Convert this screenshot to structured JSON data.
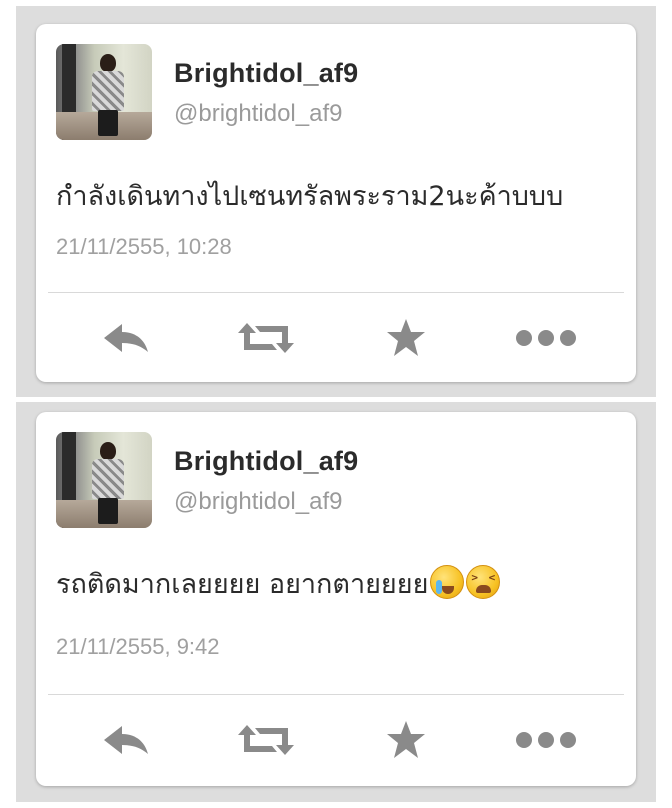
{
  "colors": {
    "background": "#dddddd",
    "card": "#ffffff",
    "name_text": "#2b2b2b",
    "meta_text": "#9a9a9a",
    "icon": "#8a8a8a"
  },
  "tweets": [
    {
      "name": "Brightidol_af9",
      "handle": "@brightidol_af9",
      "text": "กำลังเดินทางไปเซนทรัลพระราม2นะค้าบบบ",
      "emojis": [],
      "timestamp": "21/11/2555, 10:28",
      "actions": [
        "reply-icon",
        "retweet-icon",
        "favorite-star-icon",
        "more-icon"
      ]
    },
    {
      "name": "Brightidol_af9",
      "handle": "@brightidol_af9",
      "text": "รถติดมากเลยยยย อยากตายยยย",
      "emojis": [
        "crying-face-emoji",
        "tired-face-emoji"
      ],
      "timestamp": "21/11/2555, 9:42",
      "actions": [
        "reply-icon",
        "retweet-icon",
        "favorite-star-icon",
        "more-icon"
      ]
    }
  ]
}
